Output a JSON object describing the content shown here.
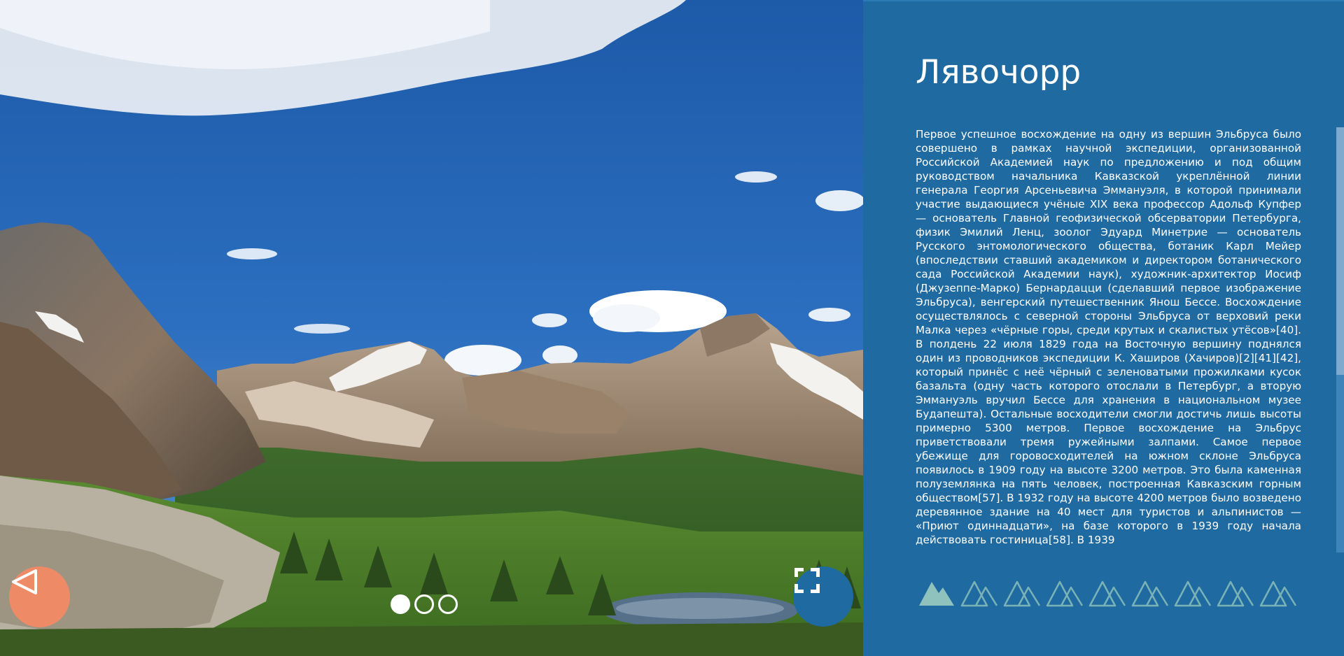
{
  "slide": {
    "title": "Лявочорр",
    "text": "Первое успешное восхождение на одну из вершин Эльбруса было совершено в рамках научной экспедиции, организованной Российской Академией наук по предложению и под общим руководством начальника Кавказской укреплённой линии генерала Георгия Арсеньевича Эммануэля, в которой принимали участие выдающиеся учёные XIX века профессор Адольф Купфер — основатель Главной геофизической обсерватории Петербурга, физик Эмилий Ленц, зоолог Эдуард Минетрие — основатель Русского энтомологического общества, ботаник Карл Мейер (впоследствии ставший академиком и директором ботанического сада Российской Академии наук), художник-архитектор Иосиф (Джузеппе-Марко) Бернардацци (сделавший первое изображение Эльбруса), венгерский путешественник Янош Бессе. Восхождение осуществлялось с северной стороны Эльбруса от верховий реки Малка через «чёрные горы, среди крутых и скалистых утёсов»[40]. В полдень 22 июля 1829 года на Восточную вершину поднялся один из проводников экспедиции К. Хаширов (Хачиров)[2][41][42], который принёс с неё чёрный с зеленоватыми прожилками кусок базальта (одну часть которого отослали в Петербург, а вторую Эммануэль вручил Бессе для хранения в национальном музее Будапешта). Остальные восходители смогли достичь лишь высоты примерно 5300 метров. Первое восхождение на Эльбрус приветствовали тремя ружейными залпами. Самое первое убежище для горовосходителей на южном склоне Эльбруса появилось в 1909 году на высоте 3200 метров. Это была каменная полуземлянка на пять человек, построенная Кавказским горным обществом[57]. В 1932 году на высоте 4200 метров было возведено деревянное здание на 40 мест для туристов и альпинистов — «Приют одиннадцати», на базе которого в 1939 году начала действовать гостиница[58]. В 1939"
  },
  "photo": {
    "alt_icon": "mountain-lake-photo"
  },
  "controls": {
    "prev_icon": "triangle-left-icon",
    "fullscreen_icon": "expand-icon",
    "dots": [
      {
        "active": true
      },
      {
        "active": false
      },
      {
        "active": false
      }
    ],
    "thumbnails": [
      {
        "active": true
      },
      {
        "active": false
      },
      {
        "active": false
      },
      {
        "active": false
      },
      {
        "active": false
      },
      {
        "active": false
      },
      {
        "active": false
      },
      {
        "active": false
      },
      {
        "active": false
      }
    ]
  },
  "colors": {
    "panel": "#1f6aa1",
    "accent_prev": "#ef8a66",
    "thumb_active": "#8fc2bd",
    "thumb_outline": "#7ab3b6"
  }
}
